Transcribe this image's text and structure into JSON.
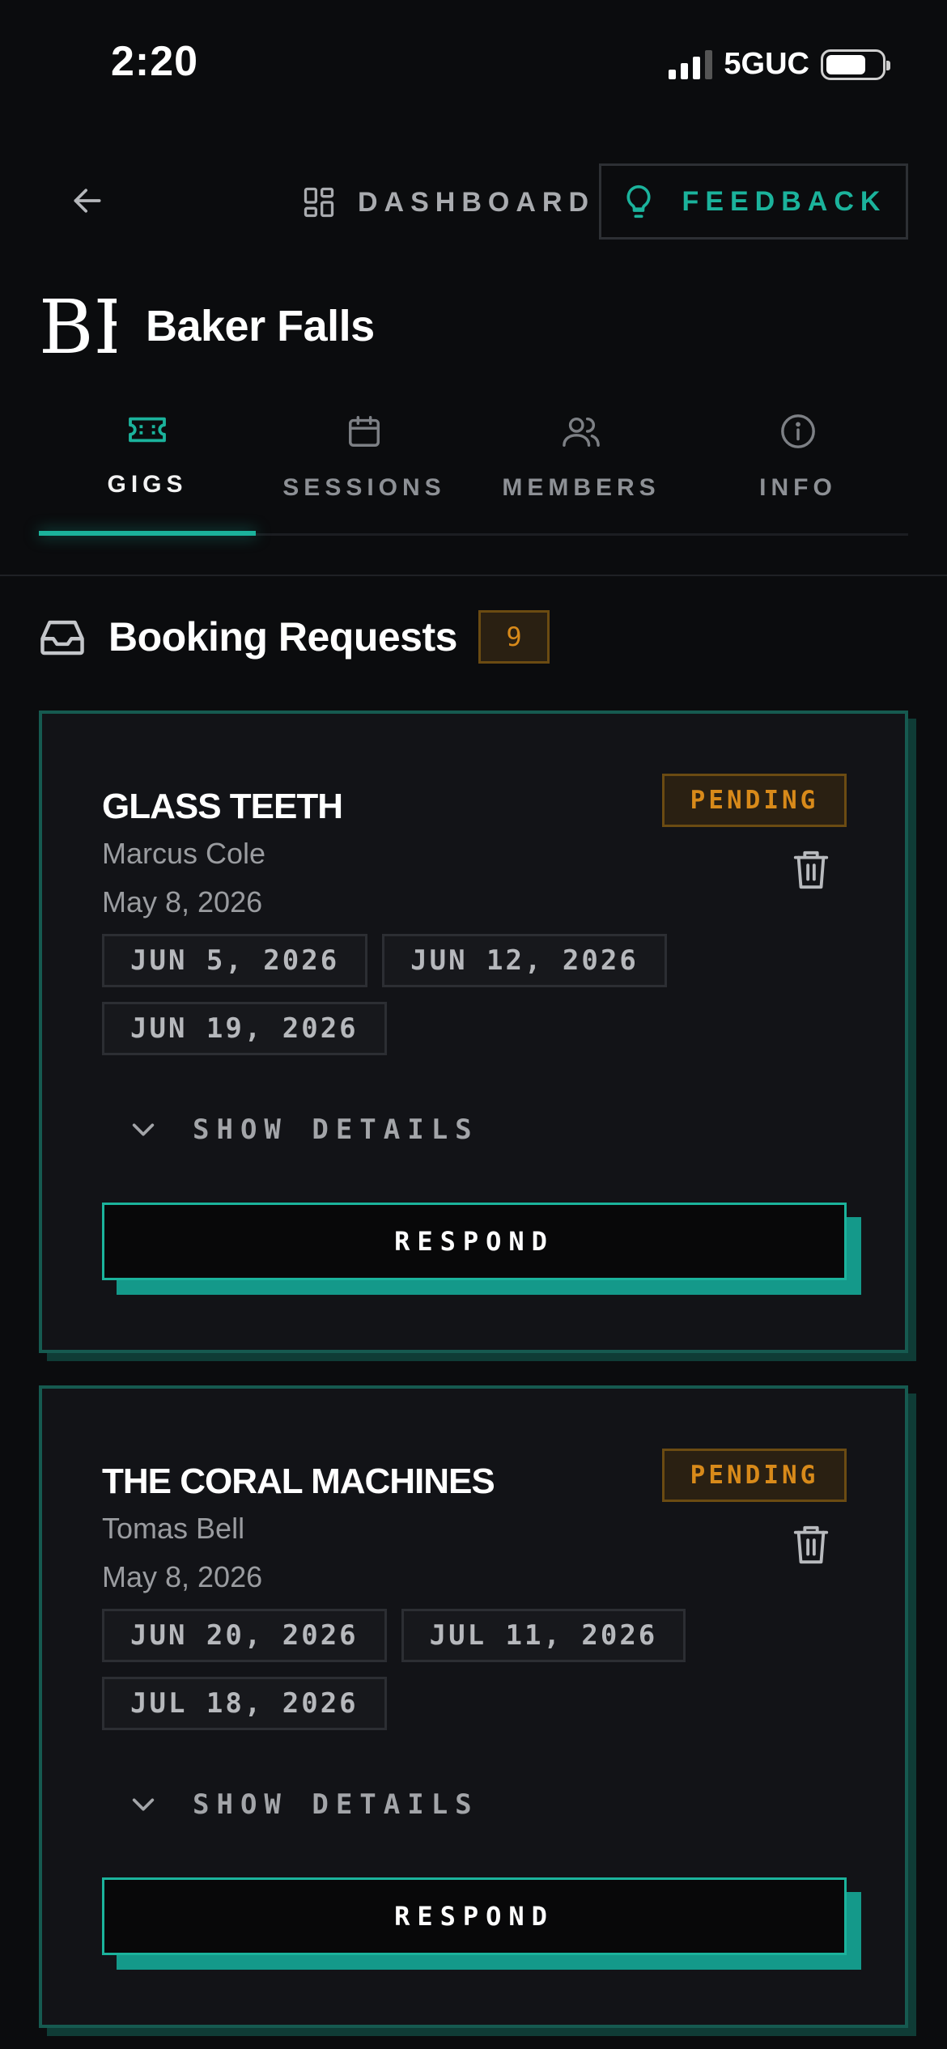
{
  "status_bar": {
    "time": "2:20",
    "network": "5GUC"
  },
  "nav": {
    "dashboard_label": "DASHBOARD",
    "feedback_label": "FEEDBACK"
  },
  "band": {
    "logo_text": "BF",
    "name": "Baker Falls"
  },
  "tabs": [
    {
      "label": "GIGS",
      "icon": "ticket-icon",
      "active": true
    },
    {
      "label": "SESSIONS",
      "icon": "calendar-icon",
      "active": false
    },
    {
      "label": "MEMBERS",
      "icon": "users-icon",
      "active": false
    },
    {
      "label": "INFO",
      "icon": "info-icon",
      "active": false
    }
  ],
  "section": {
    "title": "Booking Requests",
    "count": "9"
  },
  "requests": [
    {
      "title": "GLASS TEETH",
      "requester": "Marcus Cole",
      "date": "May 8, 2026",
      "status": "PENDING",
      "dates": [
        "JUN 5, 2026",
        "JUN 12, 2026",
        "JUN 19, 2026"
      ],
      "details_label": "SHOW DETAILS",
      "respond_label": "RESPOND"
    },
    {
      "title": "THE CORAL MACHINES",
      "requester": "Tomas Bell",
      "date": "May 8, 2026",
      "status": "PENDING",
      "dates": [
        "JUN 20, 2026",
        "JUL 11, 2026",
        "JUL 18, 2026"
      ],
      "details_label": "SHOW DETAILS",
      "respond_label": "RESPOND"
    }
  ],
  "colors": {
    "accent": "#1bb39c",
    "pending": "#d88a1a",
    "background": "#0b0c0e",
    "card": "#121317"
  }
}
